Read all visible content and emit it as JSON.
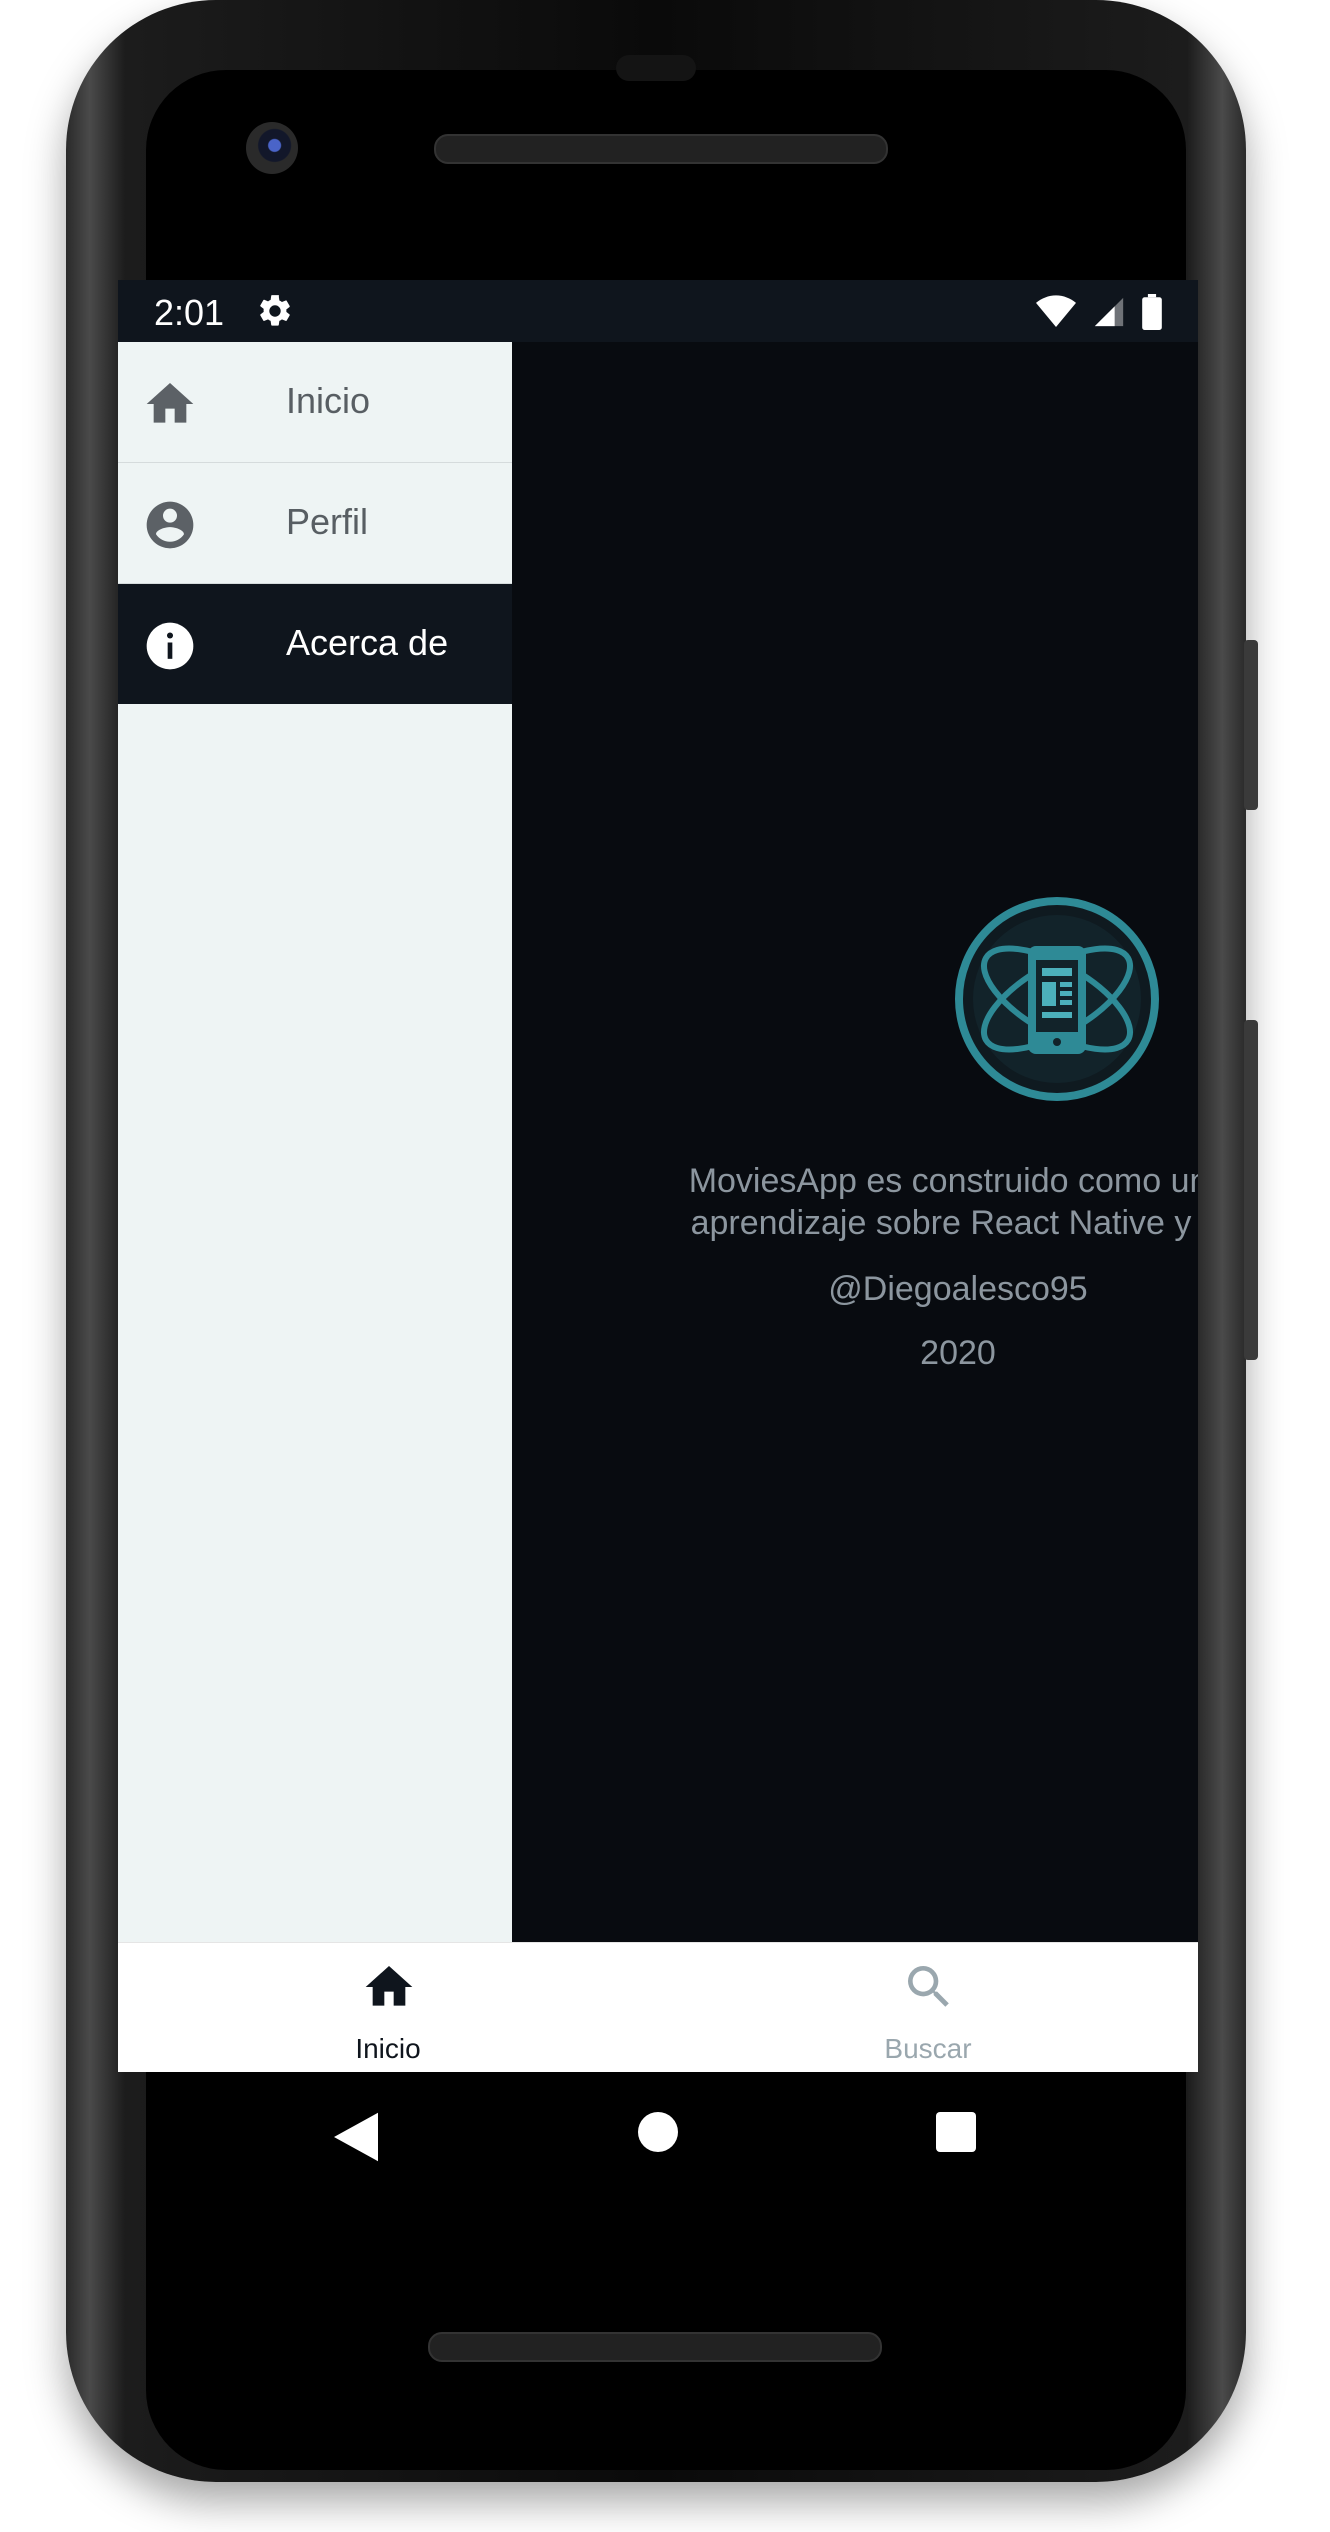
{
  "status_bar": {
    "time": "2:01",
    "icons": [
      "gear-icon",
      "wifi-icon",
      "signal-icon",
      "battery-icon"
    ]
  },
  "drawer": {
    "items": [
      {
        "label": "Inicio",
        "icon": "home-icon",
        "active": false
      },
      {
        "label": "Perfil",
        "icon": "account-circle-icon",
        "active": false
      },
      {
        "label": "Acerca de",
        "icon": "info-icon",
        "active": true
      }
    ]
  },
  "about": {
    "description_line1": "MoviesApp es construido como una",
    "description_line2": "aprendizaje sobre React Native y R",
    "author": "@Diegoalesco95",
    "year": "2020"
  },
  "tab_bar": {
    "tabs": [
      {
        "label": "Inicio",
        "icon": "home-icon",
        "active": true
      },
      {
        "label": "Buscar",
        "icon": "search-icon",
        "active": false
      }
    ]
  },
  "navigation_bar": {
    "buttons": [
      "back-icon",
      "home-circle-icon",
      "recents-icon"
    ]
  },
  "colors": {
    "screen_bg": "#080b10",
    "drawer_bg": "#eef4f4",
    "active_item_bg": "#0f151d",
    "accent_teal": "#2e8a96",
    "tab_active": "#0f151d",
    "tab_inactive": "#9aa7ae"
  }
}
